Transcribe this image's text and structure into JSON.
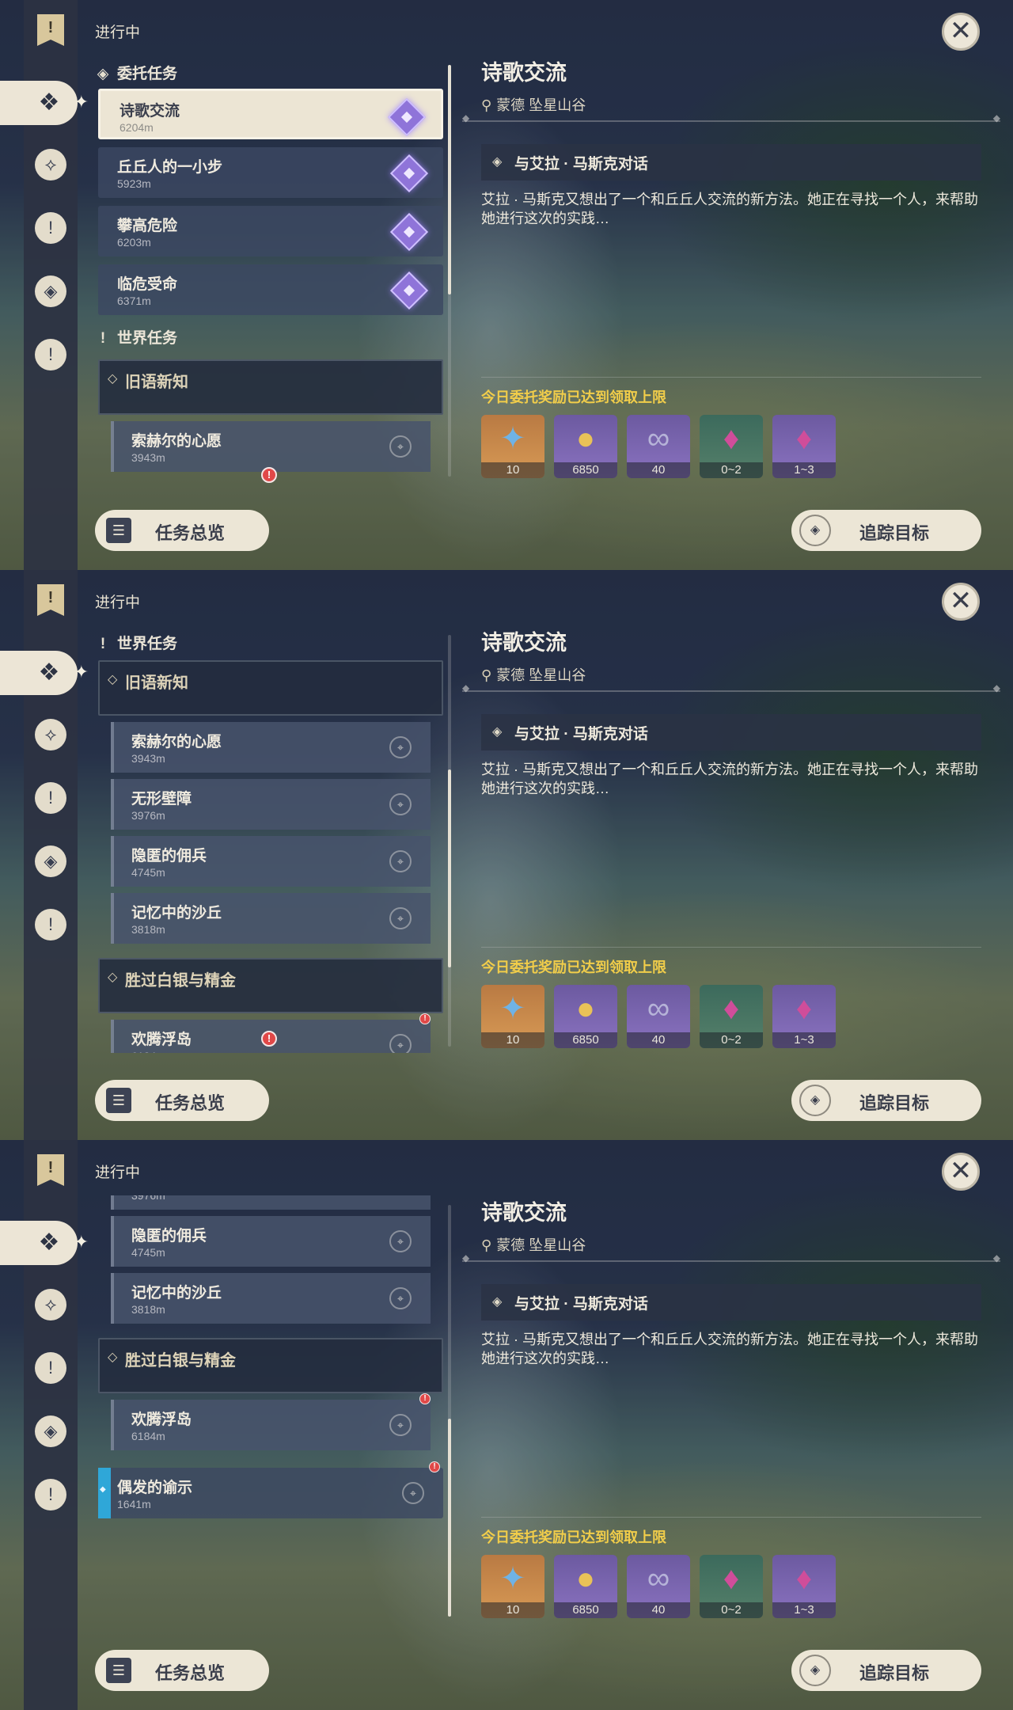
{
  "header": {
    "in_progress": "进行中"
  },
  "sections": {
    "commission": "委托任务",
    "world": "世界任务"
  },
  "commissions": [
    {
      "name": "诗歌交流",
      "distance": "6204m"
    },
    {
      "name": "丘丘人的一小步",
      "distance": "5923m"
    },
    {
      "name": "攀高危险",
      "distance": "6203m"
    },
    {
      "name": "临危受命",
      "distance": "6371m"
    }
  ],
  "world_groups": [
    {
      "title": "旧语新知",
      "quests": [
        {
          "name": "索赫尔的心愿",
          "distance": "3943m"
        },
        {
          "name": "无形壁障",
          "distance": "3976m"
        },
        {
          "name": "隐匿的佣兵",
          "distance": "4745m"
        },
        {
          "name": "记忆中的沙丘",
          "distance": "3818m"
        }
      ]
    },
    {
      "title": "胜过白银与精金",
      "quests": [
        {
          "name": "欢腾浮岛",
          "distance": "6184m"
        }
      ]
    }
  ],
  "tracked_quest": {
    "name": "偶发的谕示",
    "distance": "1641m"
  },
  "detail": {
    "title": "诗歌交流",
    "location": "蒙德 坠星山谷",
    "objective": "与艾拉 · 马斯克对话",
    "description": "艾拉 · 马斯克又想出了一个和丘丘人交流的新方法。她正在寻找一个人，来帮助她进行这次的实践…",
    "reward_note": "今日委托奖励已达到领取上限",
    "rewards": [
      {
        "icon": "adventure-exp-icon",
        "count": "10"
      },
      {
        "icon": "mora-icon",
        "count": "6850"
      },
      {
        "icon": "friendship-exp-icon",
        "count": "40"
      },
      {
        "icon": "crystal-chunk-icon",
        "count": "0~2"
      },
      {
        "icon": "crystal-cluster-icon",
        "count": "1~3"
      }
    ]
  },
  "buttons": {
    "overview": "任务总览",
    "track": "追踪目标"
  },
  "colors": {
    "reward_note": "#f1cd4a",
    "tracked_accent": "#2fa7d8",
    "alert": "#e04848",
    "commission_gem": "#8f74d9"
  }
}
